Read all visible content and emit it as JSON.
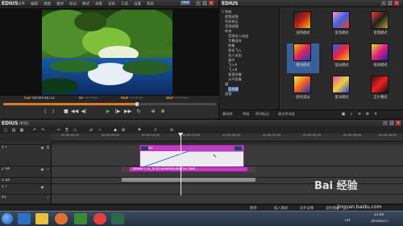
{
  "player": {
    "app_name": "EDIUS",
    "menu": [
      "文件",
      "编辑",
      "视图",
      "素材",
      "标记",
      "模式",
      "采集",
      "渲染",
      "工具",
      "设置",
      "帮助"
    ],
    "mode_tag": "PLR",
    "timecodes": [
      {
        "label": "Cur",
        "value": "00:00:00;13"
      },
      {
        "label": "In",
        "value": "--:--:--;--"
      },
      {
        "label": "Out",
        "value": "--:--:--;--"
      },
      {
        "label": "Dur",
        "value": "--:--:--;--"
      }
    ],
    "playhead_fraction": 0.63,
    "icons": [
      "set-in-icon",
      "set-out-icon",
      "stop-icon",
      "rewind-icon",
      "step-back-icon",
      "play-icon",
      "step-forward-icon",
      "fast-forward-icon",
      "loop-icon",
      "insert-icon",
      "overwrite-icon"
    ]
  },
  "bin": {
    "title": "EDIUS",
    "tree": [
      "特效",
      "视频滤镜",
      "色彩校正",
      "音频滤镜",
      "转场",
      "音频淡入淡出",
      "字幕混合",
      "划像",
      "柔化飞入",
      "淡入淡出",
      "激光",
      "飞入A",
      "飞入B",
      "垂直划像",
      "水平划像",
      "键",
      "混合器",
      "滤镜"
    ],
    "selected_tree_item": "混合器",
    "tree_short_labels": [
      "1 特效",
      "视频滤镜",
      "色彩校正",
      "音频滤镜",
      "转场",
      "音频淡入淡出",
      "字幕混合",
      "划像",
      "柔化飞入",
      "淡入淡出",
      "激光",
      "飞入A",
      "飞入B",
      "垂直划像",
      "水平划像",
      "键",
      "混合器",
      "滤镜"
    ],
    "effects": [
      {
        "label": "减色模式"
      },
      {
        "label": "变亮模式"
      },
      {
        "label": "变暗模式"
      },
      {
        "label": "叠加模式"
      },
      {
        "label": "强光模式"
      },
      {
        "label": "排除模式"
      },
      {
        "label": "颜色减淡"
      },
      {
        "label": "柔光模式"
      },
      {
        "label": "正片叠底"
      }
    ],
    "tabs": [
      "素材库",
      "特效",
      "序列标记",
      "源文件浏览"
    ]
  },
  "timeline": {
    "title": "EDIUS",
    "sequence": "序列1",
    "ruler_labels": [
      "00:00:00;00",
      "00:00:05;00",
      "00:00:10;00",
      "00:00:15;00",
      "00:00:20;00",
      "00:00:25;00",
      "00:00:30;00",
      "00:00:35;00",
      "00:00:40;00"
    ],
    "tracks": [
      {
        "name": "1 T"
      },
      {
        "name": "2 VA"
      },
      {
        "name": "1 VA"
      },
      {
        "name": "1 T"
      },
      {
        "name": "A1"
      }
    ],
    "clip1_name": "B2",
    "clip2_name": "BeeEFT13_hcb1wv84ebuba7rE7aad",
    "status": [
      "暂停",
      "插入模式",
      "同步录像",
      "波纹模式"
    ],
    "status_left": "暂停"
  },
  "taskbar": {
    "tray_lang": "CH",
    "time": "23:40",
    "date": "2016/6/17"
  },
  "watermark": {
    "text": "Bai 经验",
    "url": "jingyan.baidu.com"
  }
}
